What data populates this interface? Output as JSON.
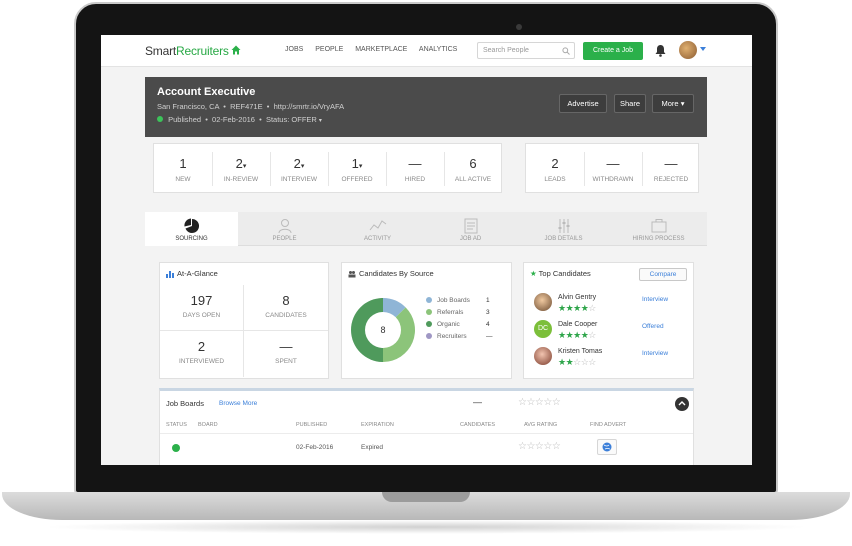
{
  "nav": {
    "logo_main": "Smart",
    "logo_accent": "Recruiters",
    "links": [
      "Jobs",
      "People",
      "Marketplace",
      "Analytics"
    ],
    "search_placeholder": "Search People",
    "create_label": "Create a Job"
  },
  "job": {
    "title": "Account Executive",
    "location": "San Francisco, CA",
    "ref": "REF471E",
    "url": "http://smrtr.io/VryAFA",
    "published_label": "Published",
    "published_date": "02-Feb-2016",
    "status_label": "Status: OFFER",
    "actions": [
      "Advertise",
      "Share",
      "More"
    ]
  },
  "pipeline": [
    {
      "num": "1",
      "label": "New"
    },
    {
      "num": "2",
      "label": "In-Review"
    },
    {
      "num": "2",
      "label": "Interview"
    },
    {
      "num": "1",
      "label": "Offered"
    },
    {
      "num": "—",
      "label": "Hired"
    },
    {
      "num": "6",
      "label": "All Active"
    }
  ],
  "pipeline_extra": [
    {
      "num": "2",
      "label": "Leads"
    },
    {
      "num": "—",
      "label": "Withdrawn"
    },
    {
      "num": "—",
      "label": "Rejected"
    }
  ],
  "tabs": [
    "Sourcing",
    "People",
    "Activity",
    "Job Ad",
    "Job Details",
    "Hiring Process"
  ],
  "glance": {
    "title": "At-A-Glance",
    "cells": [
      {
        "num": "197",
        "label": "Days Open"
      },
      {
        "num": "8",
        "label": "Candidates"
      },
      {
        "num": "2",
        "label": "Interviewed"
      },
      {
        "num": "—",
        "label": "Spent"
      }
    ]
  },
  "sources": {
    "title": "Candidates By Source",
    "total": "8",
    "items": [
      {
        "name": "Job Boards",
        "value": "1",
        "count": 1,
        "color": "#8fb5d6"
      },
      {
        "name": "Referrals",
        "value": "3",
        "count": 3,
        "color": "#8cc47a"
      },
      {
        "name": "Organic",
        "value": "4",
        "count": 4,
        "color": "#4f9a5c"
      },
      {
        "name": "Recruiters",
        "value": "—",
        "count": 0,
        "color": "#9f97c4"
      }
    ]
  },
  "top": {
    "title": "Top Candidates",
    "compare_label": "Compare",
    "candidates": [
      {
        "name": "Alvin Gentry",
        "stars": 4,
        "status": "Interview",
        "initials": ""
      },
      {
        "name": "Dale Cooper",
        "stars": 4,
        "status": "Offered",
        "initials": "DC"
      },
      {
        "name": "Kristen Tomas",
        "stars": 2,
        "status": "Interview",
        "initials": ""
      }
    ]
  },
  "boards": {
    "title": "Job Boards",
    "browse_label": "Browse More",
    "dash": "—",
    "columns": [
      "Status",
      "Board",
      "Published",
      "Expiration",
      "Candidates",
      "Avg Rating",
      "Find Advert"
    ],
    "row": {
      "published": "02-Feb-2016",
      "expiration": "Expired"
    }
  },
  "colors": {
    "brand_green": "#2bb04a",
    "header_dark": "#4b4b4b",
    "link_blue": "#3b7fd9"
  }
}
